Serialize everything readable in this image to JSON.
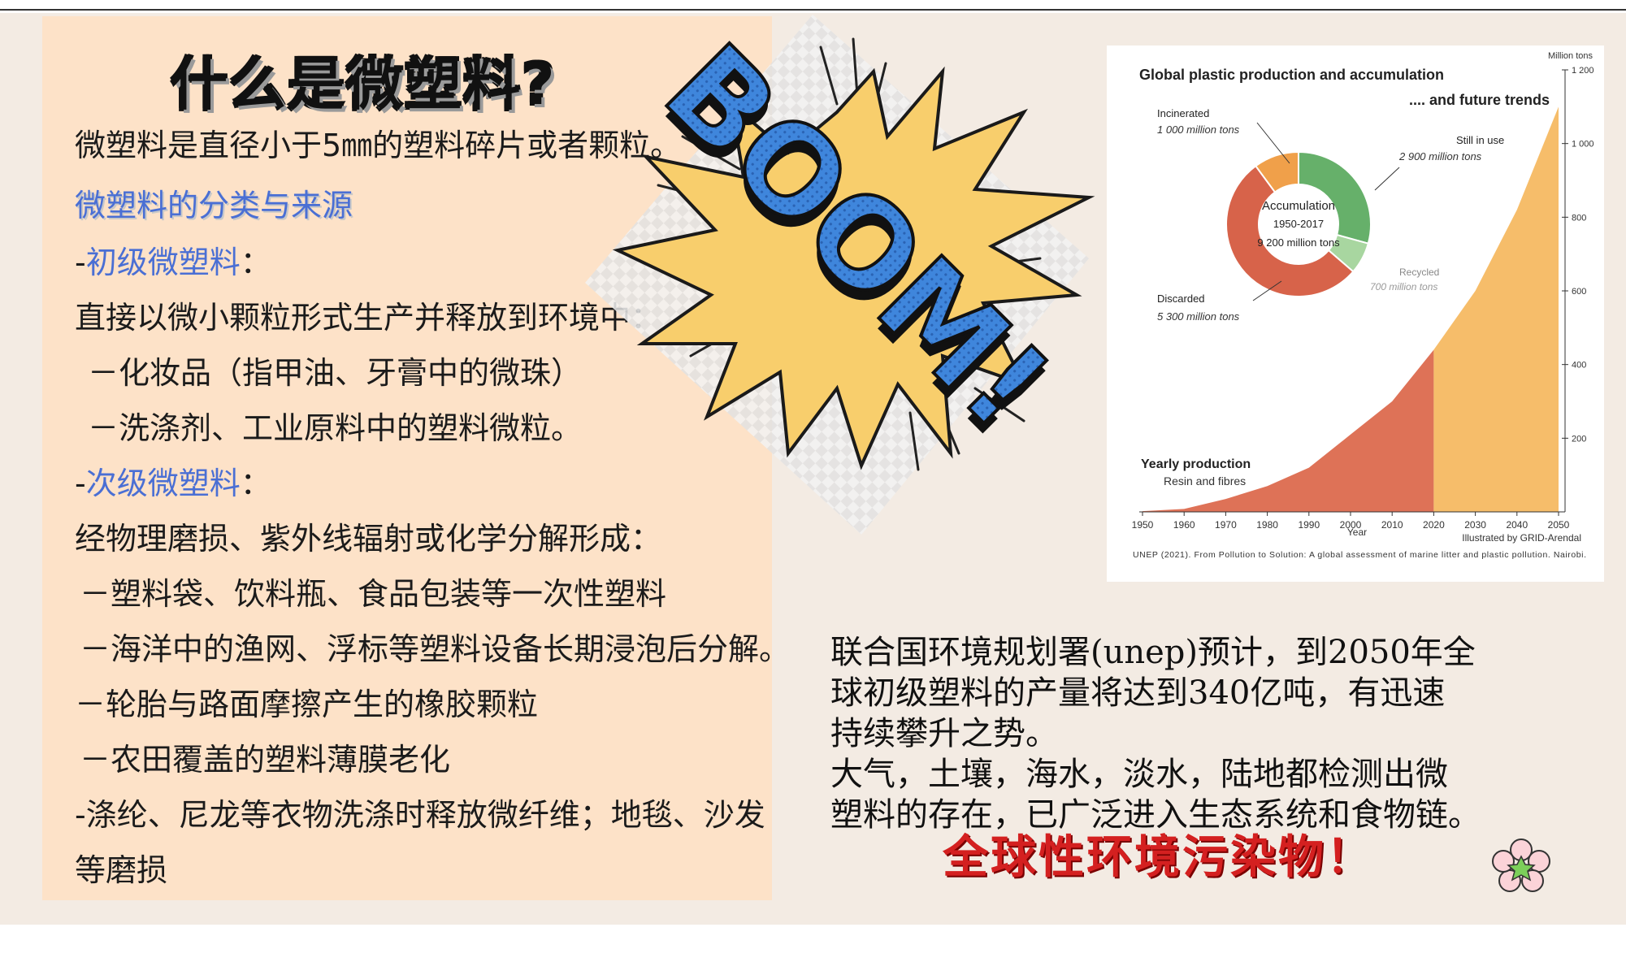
{
  "title": "什么是微塑料?",
  "left": {
    "definition": "微塑料是直径小于5㎜的塑料碎片或者颗粒。",
    "section_heading": "微塑料的分类与来源",
    "primary_dash": "-",
    "primary_label": "初级微塑料",
    "primary_colon": "：",
    "primary_desc": "直接以微小颗粒形式生产并释放到环境中：",
    "primary_items": [
      "－化妆品（指甲油、牙膏中的微珠）",
      "－洗涤剂、工业原料中的塑料微粒。"
    ],
    "secondary_dash": "-",
    "secondary_label": "次级微塑料",
    "secondary_colon": "：",
    "secondary_desc": "经物理磨损、紫外线辐射或化学分解形成：",
    "secondary_items": [
      "－塑料袋、饮料瓶、食品包装等一次性塑料",
      "－海洋中的渔网、浮标等塑料设备长期浸泡后分解。",
      "－轮胎与路面摩擦产生的橡胶颗粒",
      "－农田覆盖的塑料薄膜老化",
      "-涤纶、尼龙等衣物洗涤时释放微纤维；地毯、沙发",
      "等磨损"
    ]
  },
  "boom_text": "BOOM!",
  "chart_data": {
    "type": "area",
    "title": "Global plastic production and accumulation",
    "subtitle": ".... and future trends",
    "ylabel": "Million tons",
    "xlabel": "Year",
    "x": [
      1950,
      1960,
      1970,
      1980,
      1990,
      2000,
      2010,
      2020,
      2030,
      2040,
      2050
    ],
    "x_ticks": [
      "1950",
      "1960",
      "1970",
      "1980",
      "1990",
      "2000",
      "2010",
      "2020",
      "2030",
      "2040",
      "2050"
    ],
    "y_ticks": [
      "200",
      "400",
      "600",
      "800",
      "1 000",
      "1 200"
    ],
    "ylim": [
      0,
      1200
    ],
    "series": [
      {
        "name": "Yearly production",
        "subname": "Resin and fibres",
        "x": [
          1950,
          1960,
          1970,
          1980,
          1990,
          2000,
          2010,
          2020
        ],
        "values": [
          2,
          8,
          35,
          70,
          120,
          210,
          300,
          440
        ]
      },
      {
        "x": [
          2020,
          2030,
          2040,
          2050
        ],
        "values": [
          440,
          600,
          820,
          1100
        ]
      }
    ],
    "donut": {
      "center": [
        "Accumulation",
        "1950-2017",
        "9 200 million tons"
      ],
      "slices": [
        {
          "name": "Discarded",
          "value_label": "5 300  million tons",
          "value": 5300,
          "color": "#d7634a"
        },
        {
          "name": "Incinerated",
          "value_label": "1 000 million tons",
          "value": 1000,
          "color": "#f0a04a"
        },
        {
          "name": "Still in use",
          "value_label": "2 900 million tons",
          "value": 2900,
          "color": "#66b06a"
        },
        {
          "name": "Recycled",
          "value_label": "700 million tons",
          "value": 700,
          "color": "#a8d6a0"
        }
      ]
    },
    "credit": "Illustrated by GRID-Arendal",
    "source": "UNEP (2021). From Pollution to Solution: A global assessment of marine litter and plastic pollution. Nairobi.",
    "colors": {
      "past": "#de7257",
      "future": "#f6bd6a"
    }
  },
  "right": {
    "lines": [
      "联合国环境规划署(unep)预计，到2050年全",
      "球初级塑料的产量将达到340亿吨，有迅速",
      "持续攀升之势。",
      "大气，土壤，海水，淡水，陆地都检测出微",
      "塑料的存在，已广泛进入生态系统和食物链。"
    ],
    "emphasis": "全球性环境污染物！"
  }
}
